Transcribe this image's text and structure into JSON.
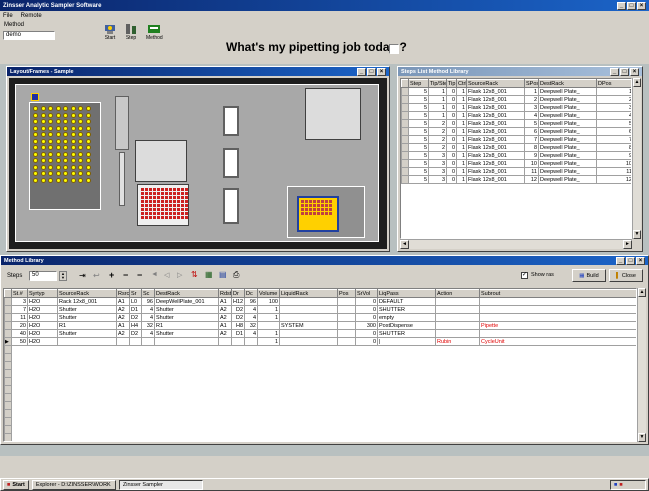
{
  "app": {
    "title": "Zinsser Analytic Sampler Software",
    "menu": [
      "File",
      "Remote"
    ],
    "window_buttons": [
      "_",
      "□",
      "×"
    ]
  },
  "method": {
    "label": "Method",
    "value": "demo"
  },
  "toolbar": {
    "btn1_label": "Start",
    "btn2_label": "Step",
    "btn3_label": "Method",
    "prompt": "What's my pipetting job today ?"
  },
  "layout_window": {
    "title": "Layout/Frames - Sample"
  },
  "steps_window": {
    "title": "Steps List Method Library",
    "columns": [
      "Step",
      "Tip/Step",
      "Tip",
      "Ctrl",
      "SourceRack",
      "SPos",
      "DestRack",
      "DPos"
    ],
    "rows": [
      [
        "5",
        "1",
        "0",
        "1",
        "Flask 12x8_001",
        "1",
        "Deepwell Plate_",
        "1"
      ],
      [
        "5",
        "1",
        "0",
        "1",
        "Flask 12x8_001",
        "2",
        "Deepwell Plate_",
        "2"
      ],
      [
        "5",
        "1",
        "0",
        "1",
        "Flask 12x8_001",
        "3",
        "Deepwell Plate_",
        "3"
      ],
      [
        "5",
        "1",
        "0",
        "1",
        "Flask 12x8_001",
        "4",
        "Deepwell Plate_",
        "4"
      ],
      [
        "5",
        "2",
        "0",
        "1",
        "Flask 12x8_001",
        "5",
        "Deepwell Plate_",
        "5"
      ],
      [
        "5",
        "2",
        "0",
        "1",
        "Flask 12x8_001",
        "6",
        "Deepwell Plate_",
        "6"
      ],
      [
        "5",
        "2",
        "0",
        "1",
        "Flask 12x8_001",
        "7",
        "Deepwell Plate_",
        "7"
      ],
      [
        "5",
        "2",
        "0",
        "1",
        "Flask 12x8_001",
        "8",
        "Deepwell Plate_",
        "8"
      ],
      [
        "5",
        "3",
        "0",
        "1",
        "Flask 12x8_001",
        "9",
        "Deepwell Plate_",
        "9"
      ],
      [
        "5",
        "3",
        "0",
        "1",
        "Flask 12x8_001",
        "10",
        "Deepwell Plate_",
        "10"
      ],
      [
        "5",
        "3",
        "0",
        "1",
        "Flask 12x8_001",
        "11",
        "Deepwell Plate_",
        "11"
      ],
      [
        "5",
        "3",
        "0",
        "1",
        "Flask 12x8_001",
        "12",
        "Deepwell Plate_",
        "12"
      ]
    ]
  },
  "method_window": {
    "title": "Method Library",
    "steps_label": "Steps",
    "steps_value": "50",
    "show_label": "Show ras",
    "btn_build": "Build",
    "btn_close": "Close",
    "columns": [
      "St.#",
      "Syrtyp",
      "SourceRack",
      "Rsrc",
      "Sr",
      "Sc",
      "DestRack",
      "Rdst",
      "Dr",
      "Dc",
      "Volume",
      "LiquidRack",
      "Pos",
      "SrVol",
      "LiqPass",
      "Action",
      "Subrout"
    ],
    "rows": [
      [
        "3",
        "H2O",
        "Rack 12x8_001",
        "A1",
        "L0",
        "96",
        "DeepWellPlate_001",
        "A1",
        "H12",
        "96",
        "100",
        "",
        "",
        "0",
        "DEFAULT",
        "",
        ""
      ],
      [
        "7",
        "H2O",
        "Shutter",
        "A2",
        "D1",
        "4",
        "Shutter",
        "A2",
        "D2",
        "4",
        "1",
        "",
        "",
        "0",
        "SHUTTER",
        "",
        ""
      ],
      [
        "11",
        "H2O",
        "Shutter",
        "A2",
        "D2",
        "4",
        "Shutter",
        "A2",
        "D2",
        "4",
        "1",
        "",
        "",
        "0",
        "empty",
        "",
        ""
      ],
      [
        "20",
        "H2O",
        "R1",
        "A1",
        "H4",
        "32",
        "R1",
        "A1",
        "H8",
        "32",
        "",
        "SYSTEM",
        "",
        "300",
        "PostDispense",
        "",
        "Pipette"
      ],
      [
        "40",
        "H2O",
        "Shutter",
        "A2",
        "D2",
        "4",
        "Shutter",
        "A2",
        "D1",
        "4",
        "1",
        "",
        "",
        "0",
        "SHUTTER",
        "",
        ""
      ],
      [
        "50",
        "H2O",
        "",
        "",
        "",
        "",
        "",
        "",
        "",
        "",
        "1",
        "",
        "",
        "0",
        "|",
        "Rubin",
        "CycleUnit"
      ]
    ]
  },
  "taskbar": {
    "start": "Start",
    "item1": "Explorer - D:\\ZINSSER\\WORK",
    "item2": "Zinsser Sampler"
  },
  "colors": {
    "titlebar": "#0a246a",
    "deck_bg": "#1e1e1e",
    "tube_yellow": "#ffff00",
    "plate_red": "#cc2020",
    "workspace": "#b8c0c0"
  }
}
